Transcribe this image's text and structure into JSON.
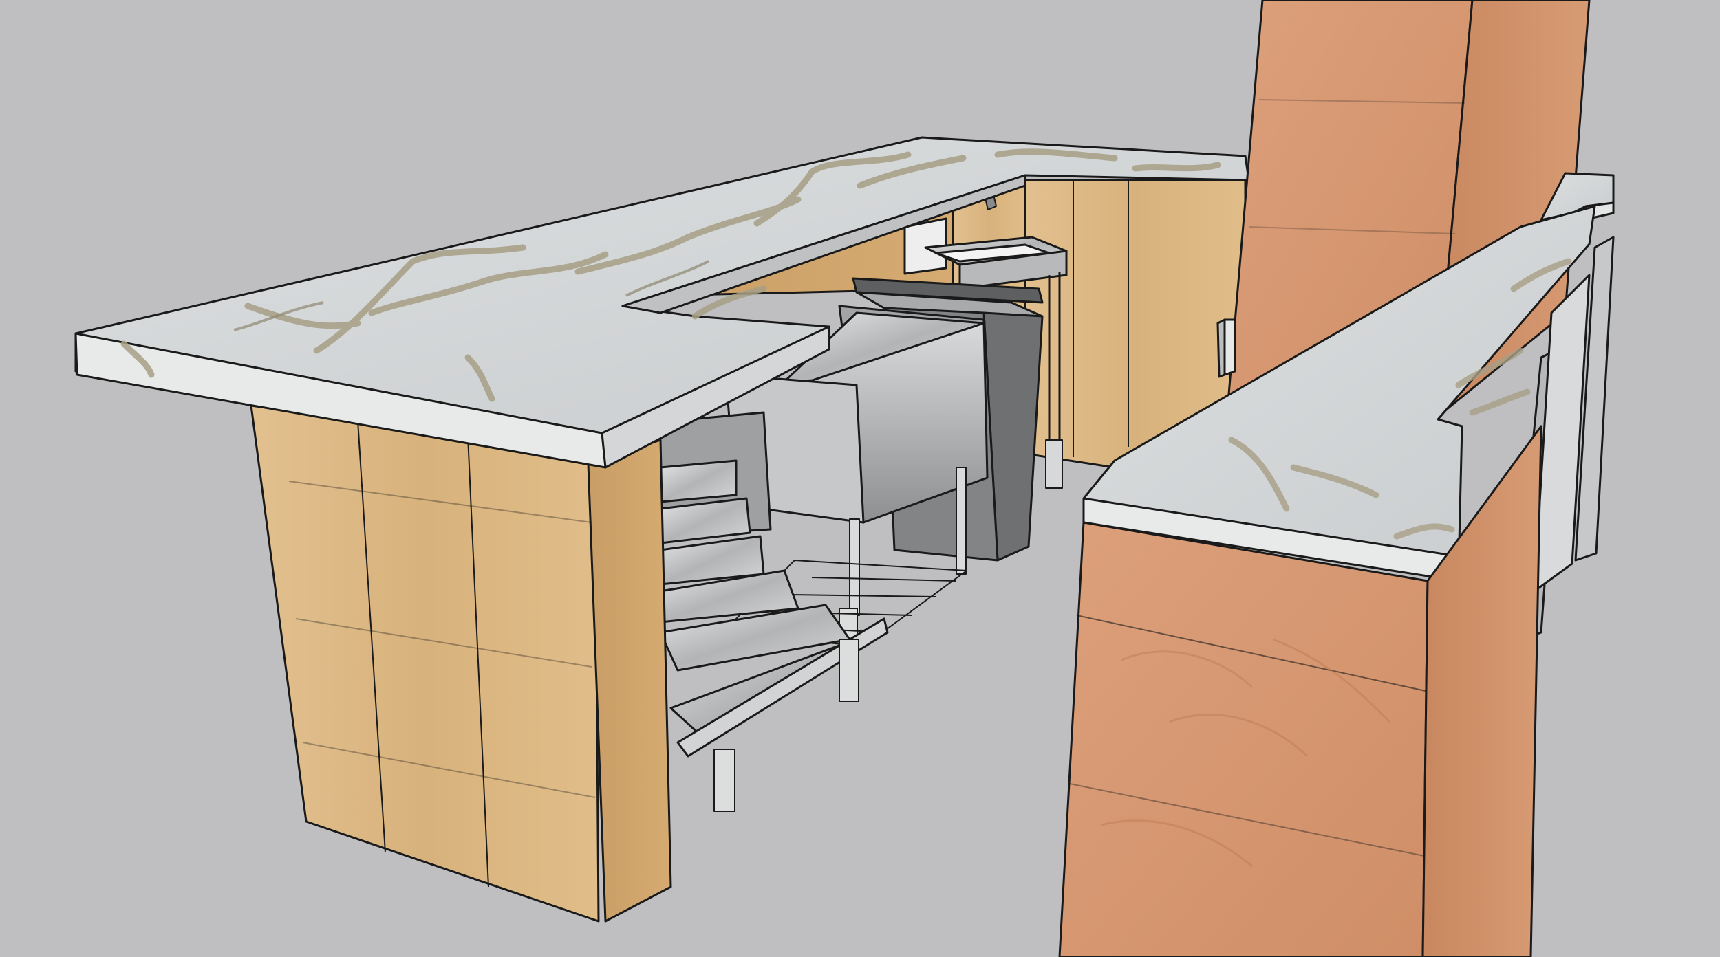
{
  "scene": {
    "background_color": "#bfbfc2",
    "materials": {
      "marble_top": "#d3d6d8",
      "marble_edge": "#e9eaea",
      "marble_vein": "#a79f86",
      "light_wood": "#dcb884",
      "red_wood": "#d79a74",
      "steel": "#b9babb",
      "steel_dark": "#7d7e80",
      "bin_dark": "#6f7072"
    }
  }
}
